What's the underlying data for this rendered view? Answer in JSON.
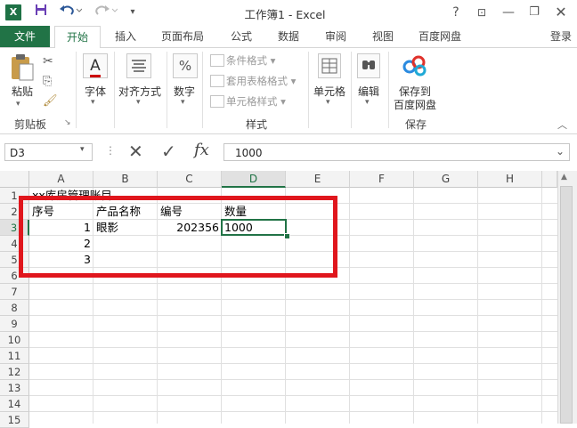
{
  "app": {
    "title": "工作簿1 - Excel",
    "logo": "X",
    "qa_icons": [
      "save-icon",
      "undo-icon",
      "redo-icon",
      "customize-icon"
    ],
    "help": "?",
    "login": "登录"
  },
  "tabs": [
    "文件",
    "开始",
    "插入",
    "页面布局",
    "公式",
    "数据",
    "审阅",
    "视图",
    "百度网盘"
  ],
  "ribbon": {
    "paste": "粘贴",
    "clipboard": "剪贴板",
    "font": "字体",
    "align": "对齐方式",
    "number": "数字",
    "number_symbol": "%",
    "cond_format": "条件格式",
    "table_format": "套用表格格式",
    "cell_style": "单元格样式",
    "styles": "样式",
    "cells": "单元格",
    "edit": "编辑",
    "save_baidu_1": "保存到",
    "save_baidu_2": "百度网盘",
    "save_group": "保存"
  },
  "formula_bar": {
    "name_box": "D3",
    "fx": "fx",
    "value": "1000"
  },
  "columns": [
    "A",
    "B",
    "C",
    "D",
    "E",
    "F",
    "G",
    "H"
  ],
  "rows": [
    "1",
    "2",
    "3",
    "4",
    "5",
    "6",
    "7",
    "8",
    "9",
    "10",
    "11",
    "12",
    "13",
    "14",
    "15"
  ],
  "cells": {
    "A1": "xx库房管理账目",
    "A2": "序号",
    "B2": "产品名称",
    "C2": "编号",
    "D2": "数量",
    "A3": "1",
    "B3": "眼影",
    "C3": "202356",
    "D3": "1000",
    "A4": "2",
    "A5": "3"
  },
  "selected_cell": "D3",
  "annotation_color": "#e0161d",
  "accent": "#217346"
}
